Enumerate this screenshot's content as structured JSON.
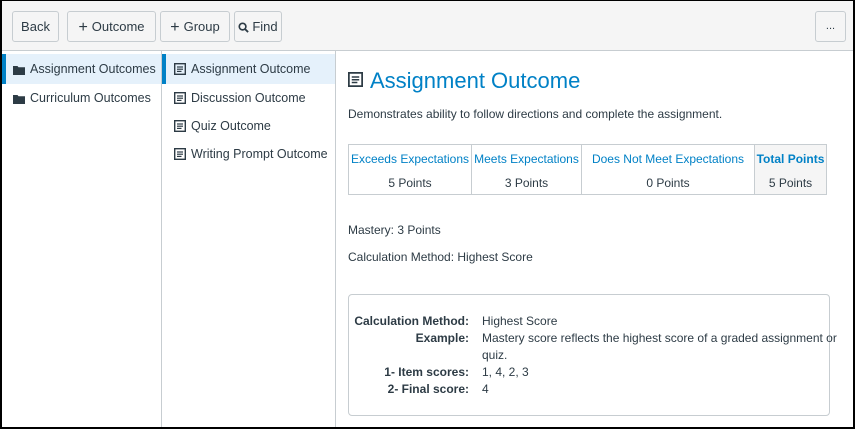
{
  "toolbar": {
    "back_label": "Back",
    "add_outcome_label": "Outcome",
    "add_group_label": "Group",
    "find_label": "Find",
    "more_label": "..."
  },
  "groups": [
    {
      "label": "Assignment Outcomes",
      "selected": true
    },
    {
      "label": "Curriculum Outcomes",
      "selected": false
    }
  ],
  "outcomes": [
    {
      "label": "Assignment Outcome",
      "selected": true
    },
    {
      "label": "Discussion Outcome",
      "selected": false
    },
    {
      "label": "Quiz Outcome",
      "selected": false
    },
    {
      "label": "Writing Prompt Outcome",
      "selected": false
    }
  ],
  "detail": {
    "title": "Assignment Outcome",
    "description": "Demonstrates ability to follow directions and complete the assignment.",
    "rubric": {
      "headers": [
        "Exceeds Expectations",
        "Meets Expectations",
        "Does Not Meet Expectations",
        "Total Points"
      ],
      "points": [
        "5 Points",
        "3 Points",
        "0 Points",
        "5 Points"
      ]
    },
    "mastery": "Mastery: 3 Points",
    "calculation": "Calculation Method: Highest Score",
    "calc_box": {
      "method_key": "Calculation Method:",
      "method_value": "Highest Score",
      "example_key": "Example:",
      "example_line1": "Mastery score reflects the highest score of a graded assignment or",
      "example_line2": "quiz.",
      "item_scores_key": "1- Item scores:",
      "item_scores_value": "1, 4, 2, 3",
      "final_score_key": "2- Final score:",
      "final_score_value": "4"
    }
  },
  "colors": {
    "accent": "#0081c6",
    "selected_bg": "#e5f1fb",
    "toolbar_bg": "#f5f5f5",
    "border": "#c7cdd1"
  }
}
